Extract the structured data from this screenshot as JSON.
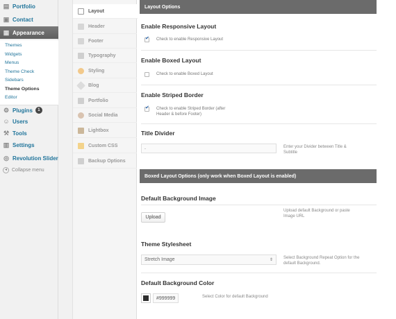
{
  "wp_menu": {
    "top_items": [
      {
        "label": "Portfolio",
        "icon": "portfolio-icon"
      },
      {
        "label": "Contact",
        "icon": "contact-icon"
      },
      {
        "label": "Appearance",
        "icon": "appearance-icon"
      }
    ],
    "appearance_sub": [
      "Themes",
      "Widgets",
      "Menus",
      "Theme Check",
      "Sidebars",
      "Theme Options",
      "Editor"
    ],
    "lower_items": [
      {
        "label": "Plugins",
        "icon": "plugins-icon",
        "badge": "1"
      },
      {
        "label": "Users",
        "icon": "users-icon"
      },
      {
        "label": "Tools",
        "icon": "tools-icon"
      },
      {
        "label": "Settings",
        "icon": "settings-icon"
      },
      {
        "label": "Revolution Slider",
        "icon": "revolution-slider-icon"
      }
    ],
    "collapse_label": "Collapse menu"
  },
  "options_nav": {
    "items": [
      "Layout",
      "Header",
      "Footer",
      "Typography",
      "Styling",
      "Blog",
      "Portfolio",
      "Social Media",
      "Lightbox",
      "Custom CSS",
      "Backup Options"
    ],
    "active": "Layout"
  },
  "layout_options": {
    "header": "Layout Options",
    "responsive": {
      "title": "Enable Responsive Layout",
      "check_label": "Check to enable Responsive Layout",
      "checked": true
    },
    "boxed": {
      "title": "Enable Boxed Layout",
      "check_label": "Check to enable Boxed Layout",
      "checked": false
    },
    "striped": {
      "title": "Enable Striped Border",
      "check_label_1": "Check to enable Striped Border (after",
      "check_label_2": "Header & before Footer)",
      "checked": true
    },
    "title_divider": {
      "title": "Title Divider",
      "value": ".",
      "help_1": "Enter your Divider between Title &",
      "help_2": "Subtitle"
    }
  },
  "boxed_options": {
    "header": "Boxed Layout Options (only work when Boxed Layout is enabled)",
    "bg_image": {
      "title": "Default Background Image",
      "button": "Upload",
      "help_1": "Upload default Background or paste",
      "help_2": "Image URL"
    },
    "stylesheet": {
      "title": "Theme Stylesheet",
      "selected": "Stretch Image",
      "help_1": "Select Background Repeat Option for the",
      "help_2": "default Background."
    },
    "bg_color": {
      "title": "Default Background Color",
      "value": "#999999",
      "help": "Select Color for default Background"
    }
  },
  "colors": {
    "link": "#21759b",
    "header_bar": "#6b6b6b",
    "active_menu": "#6d6d6d"
  }
}
